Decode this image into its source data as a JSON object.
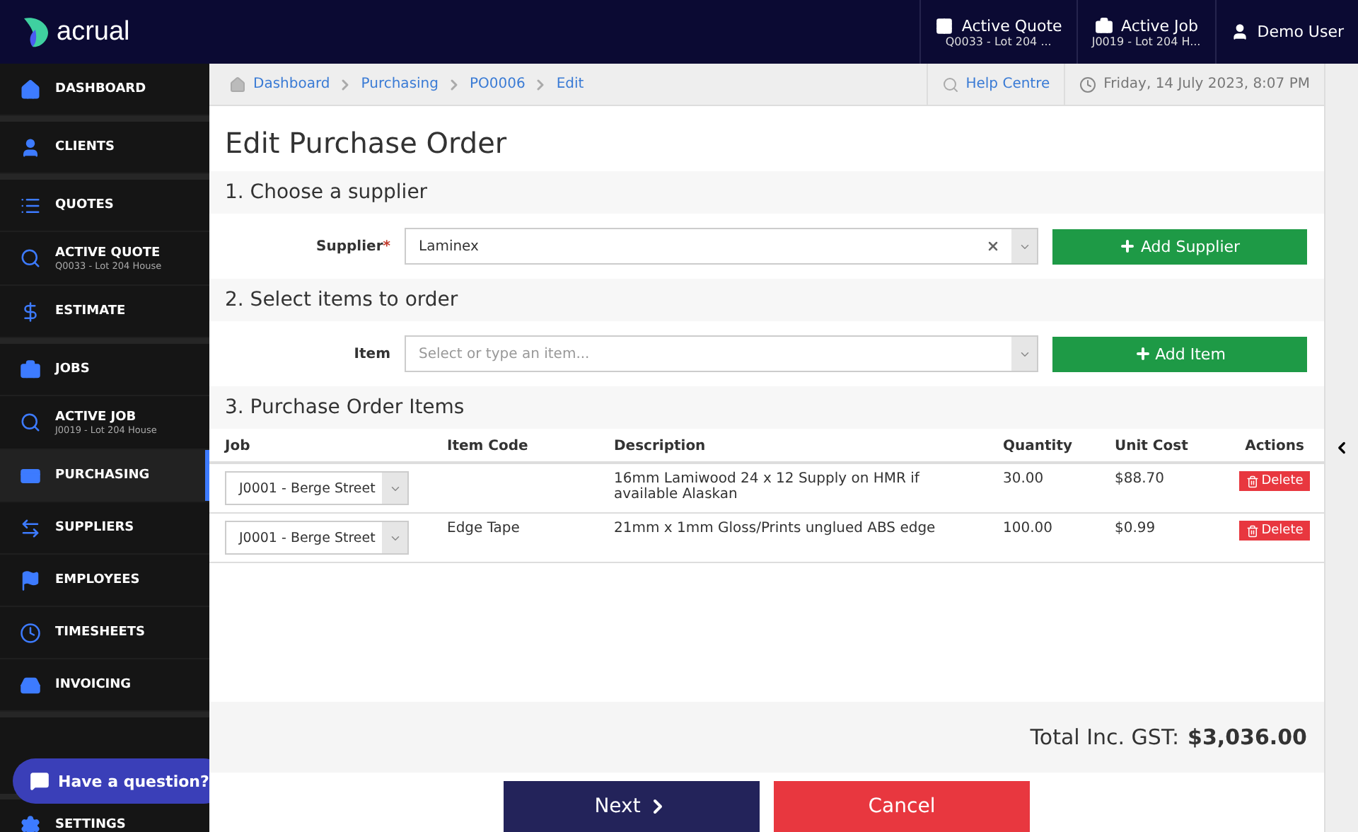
{
  "brand": {
    "name": "acrual"
  },
  "topbar": [
    {
      "label": "Active Quote",
      "sub": "Q0033 - Lot 204 ..."
    },
    {
      "label": "Active Job",
      "sub": "J0019 - Lot 204 H..."
    },
    {
      "label": "Demo User"
    }
  ],
  "sidebar": {
    "groups": [
      [
        {
          "label": "DASHBOARD",
          "selected": false
        }
      ],
      [
        {
          "label": "CLIENTS",
          "selected": false
        }
      ],
      [
        {
          "label": "QUOTES",
          "selected": false
        },
        {
          "label": "ACTIVE QUOTE",
          "sub": "Q0033 - Lot 204 House",
          "selected": false
        },
        {
          "label": "ESTIMATE",
          "selected": false
        }
      ],
      [
        {
          "label": "JOBS",
          "selected": false
        },
        {
          "label": "ACTIVE JOB",
          "sub": "J0019 - Lot 204 House",
          "selected": false
        },
        {
          "label": "PURCHASING",
          "selected": true
        },
        {
          "label": "SUPPLIERS",
          "selected": false
        },
        {
          "label": "EMPLOYEES",
          "selected": false
        },
        {
          "label": "TIMESHEETS",
          "selected": false
        },
        {
          "label": "INVOICING",
          "selected": false
        }
      ],
      [
        {
          "label": "SETTINGS",
          "selected": false
        }
      ]
    ]
  },
  "chat_button": "Have a question?",
  "breadcrumbs": [
    "Dashboard",
    "Purchasing",
    "PO0006",
    "Edit"
  ],
  "help": "Help Centre",
  "datetime": "Friday, 14 July 2023, 8:07 PM",
  "title": "Edit Purchase Order",
  "section1": {
    "heading": "1. Choose a supplier",
    "label": "Supplier",
    "required_mark": "*",
    "value": "Laminex",
    "button": "Add Supplier"
  },
  "section2": {
    "heading": "2. Select items to order",
    "label": "Item",
    "placeholder": "Select or type an item...",
    "button": "Add Item"
  },
  "section3": {
    "heading": "3. Purchase Order Items",
    "columns": [
      "Job",
      "Item Code",
      "Description",
      "Quantity",
      "Unit Cost",
      "Actions"
    ],
    "rows": [
      {
        "job": "J0001 - Berge Street",
        "code": "",
        "description": "16mm Lamiwood 24 x 12 Supply on HMR if available Alaskan",
        "quantity": "30.00",
        "cost": "$88.70",
        "action": "Delete"
      },
      {
        "job": "J0001 - Berge Street",
        "code": "Edge Tape",
        "description": "21mm x 1mm Gloss/Prints unglued ABS edge",
        "quantity": "100.00",
        "cost": "$0.99",
        "action": "Delete"
      }
    ]
  },
  "total": {
    "label": "Total Inc. GST:",
    "value": "$3,036.00"
  },
  "buttons": {
    "next": "Next",
    "cancel": "Cancel"
  }
}
